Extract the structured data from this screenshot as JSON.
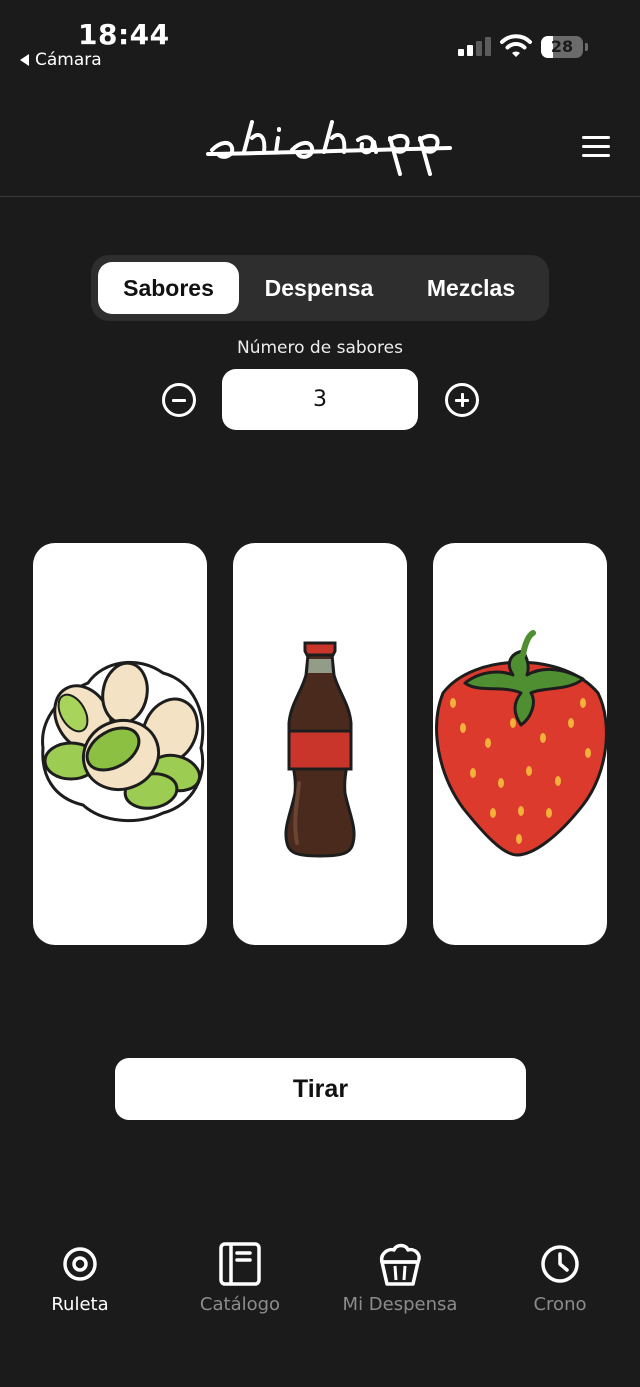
{
  "status_bar": {
    "time": "18:44",
    "back_label": "Cámara",
    "battery": "28",
    "battery_level": 0.28
  },
  "header": {
    "logo_text": "shishapp",
    "menu_icon": "hamburger-menu-icon"
  },
  "tabs": [
    {
      "label": "Sabores",
      "active": true
    },
    {
      "label": "Despensa",
      "active": false
    },
    {
      "label": "Mezclas",
      "active": false
    }
  ],
  "flavor_count": {
    "label": "Número de sabores",
    "value": "3",
    "decrement_icon": "minus-circle-icon",
    "increment_icon": "plus-circle-icon"
  },
  "cards": [
    {
      "icon": "pistachio-icon"
    },
    {
      "icon": "cola-bottle-icon"
    },
    {
      "icon": "strawberry-icon"
    }
  ],
  "actions": {
    "spin_label": "Tirar"
  },
  "bottom_nav": [
    {
      "label": "Ruleta",
      "icon": "target-icon",
      "active": true
    },
    {
      "label": "Catálogo",
      "icon": "notebook-icon",
      "active": false
    },
    {
      "label": "Mi Despensa",
      "icon": "muffin-icon",
      "active": false
    },
    {
      "label": "Crono",
      "icon": "clock-icon",
      "active": false
    }
  ],
  "colors": {
    "background": "#1b1b1b",
    "surface": "#2e2e2e",
    "accent": "#ffffff",
    "inactive_text": "#8c8c8c"
  }
}
